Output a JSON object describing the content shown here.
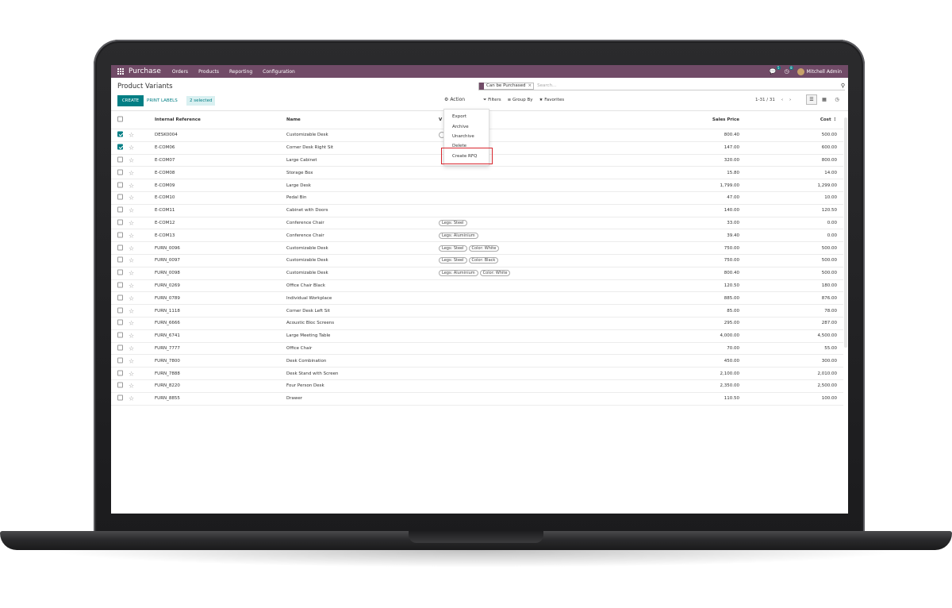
{
  "nav": {
    "app_title": "Purchase",
    "menu": [
      "Orders",
      "Products",
      "Reporting",
      "Configuration"
    ],
    "chat_count": "5",
    "activity_count": "8",
    "user": "Mitchell Admin"
  },
  "page": {
    "title": "Product Variants",
    "search_facet": "Can be Purchased",
    "search_placeholder": "Search...",
    "create_label": "CREATE",
    "print_labels_label": "PRINT LABELS",
    "selected_label": "2 selected",
    "action_label": "Action",
    "filters_label": "Filters",
    "group_by_label": "Group By",
    "favorites_label": "Favorites",
    "pager": "1-31 / 31"
  },
  "action_menu": {
    "items": [
      "Export",
      "Archive",
      "Unarchive",
      "Delete",
      "Create RFQ"
    ],
    "highlighted": "Create RFQ"
  },
  "table": {
    "columns": {
      "internal_reference": "Internal Reference",
      "name": "Name",
      "variant_values": "V",
      "sales_price": "Sales Price",
      "cost": "Cost"
    },
    "rows": [
      {
        "ref": "DESK0004",
        "name": "Customizable Desk",
        "tags": [
          "",
          "olor: Black"
        ],
        "price": "800.40",
        "cost": "500.00",
        "checked": true
      },
      {
        "ref": "E-COM06",
        "name": "Corner Desk Right Sit",
        "tags": [],
        "price": "147.00",
        "cost": "600.00",
        "checked": true
      },
      {
        "ref": "E-COM07",
        "name": "Large Cabinet",
        "tags": [],
        "price": "320.00",
        "cost": "800.00",
        "checked": false
      },
      {
        "ref": "E-COM08",
        "name": "Storage Box",
        "tags": [],
        "price": "15.80",
        "cost": "14.00",
        "checked": false
      },
      {
        "ref": "E-COM09",
        "name": "Large Desk",
        "tags": [],
        "price": "1,799.00",
        "cost": "1,299.00",
        "checked": false
      },
      {
        "ref": "E-COM10",
        "name": "Pedal Bin",
        "tags": [],
        "price": "47.00",
        "cost": "10.00",
        "checked": false
      },
      {
        "ref": "E-COM11",
        "name": "Cabinet with Doors",
        "tags": [],
        "price": "140.00",
        "cost": "120.50",
        "checked": false
      },
      {
        "ref": "E-COM12",
        "name": "Conference Chair",
        "tags": [
          "Legs: Steel"
        ],
        "price": "33.00",
        "cost": "0.00",
        "checked": false
      },
      {
        "ref": "E-COM13",
        "name": "Conference Chair",
        "tags": [
          "Legs: Aluminium"
        ],
        "price": "39.40",
        "cost": "0.00",
        "checked": false
      },
      {
        "ref": "FURN_0096",
        "name": "Customizable Desk",
        "tags": [
          "Legs: Steel",
          "Color: White"
        ],
        "price": "750.00",
        "cost": "500.00",
        "checked": false
      },
      {
        "ref": "FURN_0097",
        "name": "Customizable Desk",
        "tags": [
          "Legs: Steel",
          "Color: Black"
        ],
        "price": "750.00",
        "cost": "500.00",
        "checked": false
      },
      {
        "ref": "FURN_0098",
        "name": "Customizable Desk",
        "tags": [
          "Legs: Aluminium",
          "Color: White"
        ],
        "price": "800.40",
        "cost": "500.00",
        "checked": false
      },
      {
        "ref": "FURN_0269",
        "name": "Office Chair Black",
        "tags": [],
        "price": "120.50",
        "cost": "180.00",
        "checked": false
      },
      {
        "ref": "FURN_0789",
        "name": "Individual Workplace",
        "tags": [],
        "price": "885.00",
        "cost": "876.00",
        "checked": false
      },
      {
        "ref": "FURN_1118",
        "name": "Corner Desk Left Sit",
        "tags": [],
        "price": "85.00",
        "cost": "78.00",
        "checked": false
      },
      {
        "ref": "FURN_6666",
        "name": "Acoustic Bloc Screens",
        "tags": [],
        "price": "295.00",
        "cost": "287.00",
        "checked": false
      },
      {
        "ref": "FURN_6741",
        "name": "Large Meeting Table",
        "tags": [],
        "price": "4,000.00",
        "cost": "4,500.00",
        "checked": false
      },
      {
        "ref": "FURN_7777",
        "name": "Office Chair",
        "tags": [],
        "price": "70.00",
        "cost": "55.00",
        "checked": false
      },
      {
        "ref": "FURN_7800",
        "name": "Desk Combination",
        "tags": [],
        "price": "450.00",
        "cost": "300.00",
        "checked": false
      },
      {
        "ref": "FURN_7888",
        "name": "Desk Stand with Screen",
        "tags": [],
        "price": "2,100.00",
        "cost": "2,010.00",
        "checked": false
      },
      {
        "ref": "FURN_8220",
        "name": "Four Person Desk",
        "tags": [],
        "price": "2,350.00",
        "cost": "2,500.00",
        "checked": false
      },
      {
        "ref": "FURN_8855",
        "name": "Drawer",
        "tags": [],
        "price": "110.50",
        "cost": "100.00",
        "checked": false
      }
    ]
  },
  "colors": {
    "navbar": "#714b67",
    "primary": "#017e84",
    "highlight": "#d9272e"
  }
}
